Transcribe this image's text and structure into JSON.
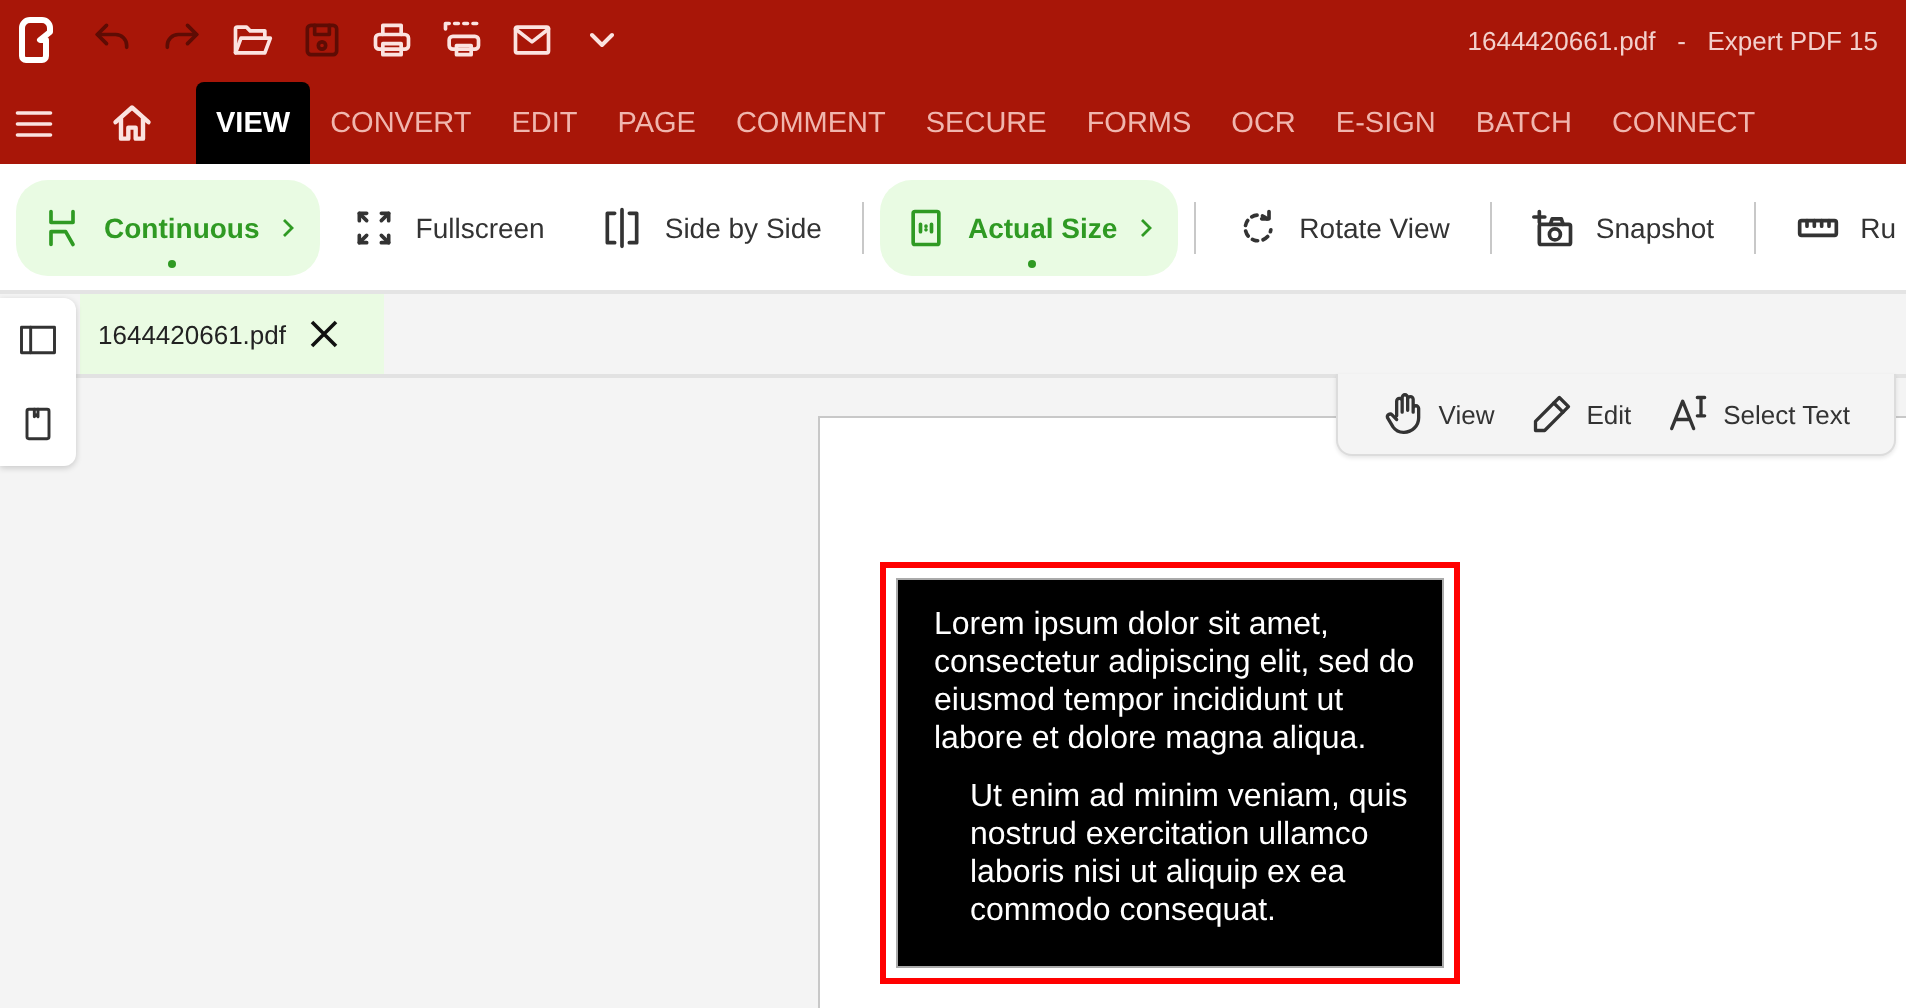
{
  "window": {
    "title": "1644420661.pdf   -   Expert PDF 15"
  },
  "quick_actions": [
    {
      "disabled": true
    },
    {
      "disabled": true
    },
    {
      "disabled": false
    },
    {
      "disabled": true
    },
    {
      "disabled": false
    },
    {
      "disabled": false
    },
    {
      "disabled": false
    },
    {
      "disabled": false
    }
  ],
  "menu_tabs": [
    {
      "label": "VIEW",
      "selected": true
    },
    {
      "label": "CONVERT",
      "selected": false
    },
    {
      "label": "EDIT",
      "selected": false
    },
    {
      "label": "PAGE",
      "selected": false
    },
    {
      "label": "COMMENT",
      "selected": false
    },
    {
      "label": "SECURE",
      "selected": false
    },
    {
      "label": "FORMS",
      "selected": false
    },
    {
      "label": "OCR",
      "selected": false
    },
    {
      "label": "E-SIGN",
      "selected": false
    },
    {
      "label": "BATCH",
      "selected": false
    },
    {
      "label": "CONNECT",
      "selected": false
    }
  ],
  "ribbon_groups": [
    [
      {
        "label": "Continuous",
        "selected": true
      },
      {
        "label": "Fullscreen",
        "selected": false
      },
      {
        "label": "Side by Side",
        "selected": false
      }
    ],
    [
      {
        "label": "Actual Size",
        "selected": true
      }
    ],
    [
      {
        "label": "Rotate View",
        "selected": false
      }
    ],
    [
      {
        "label": "Snapshot",
        "selected": false
      }
    ],
    [
      {
        "label": "Ru",
        "selected": false
      }
    ]
  ],
  "document_tab": {
    "label": "1644420661.pdf",
    "selected": true
  },
  "mode_toolbar": [
    {
      "label": "View"
    },
    {
      "label": "Edit"
    },
    {
      "label": "Select Text"
    }
  ],
  "document": {
    "paragraphs": [
      "Lorem ipsum dolor sit amet, consectetur adipiscing elit, sed do eiusmod tempor incididunt ut labore et dolore magna aliqua.",
      "Ut enim ad minim veniam, quis nostrud exercitation ullamco laboris nisi ut aliquip ex ea commodo consequat."
    ]
  }
}
